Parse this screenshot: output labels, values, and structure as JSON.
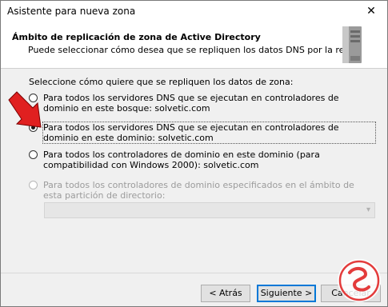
{
  "window": {
    "title": "Asistente para nueva zona",
    "close_glyph": "✕"
  },
  "header": {
    "title": "Ámbito de replicación de zona de Active Directory",
    "subtitle": "Puede seleccionar cómo desea que se repliquen los datos DNS por la red.",
    "icon": "server-icon"
  },
  "content": {
    "prompt": "Seleccione cómo quiere que se repliquen los datos de zona:",
    "options": [
      {
        "label": "Para todos los servidores DNS que se ejecutan en controladores de dominio en este bosque: solvetic.com",
        "checked": false,
        "enabled": true
      },
      {
        "label": "Para todos los servidores DNS que se ejecutan en controladores de dominio en este dominio: solvetic.com",
        "checked": true,
        "enabled": true
      },
      {
        "label": "Para todos los controladores de dominio en este dominio (para compatibilidad con Windows 2000): solvetic.com",
        "checked": false,
        "enabled": true
      },
      {
        "label": "Para todos los controladores de dominio especificados en el ámbito de esta partición de directorio:",
        "checked": false,
        "enabled": false
      }
    ],
    "partition_combo_value": ""
  },
  "buttons": {
    "back": "< Atrás",
    "next": "Siguiente >",
    "cancel": "Cancelar"
  },
  "colors": {
    "accent": "#0078d7",
    "arrow": "#e02020",
    "logo": "#e33b3b"
  }
}
